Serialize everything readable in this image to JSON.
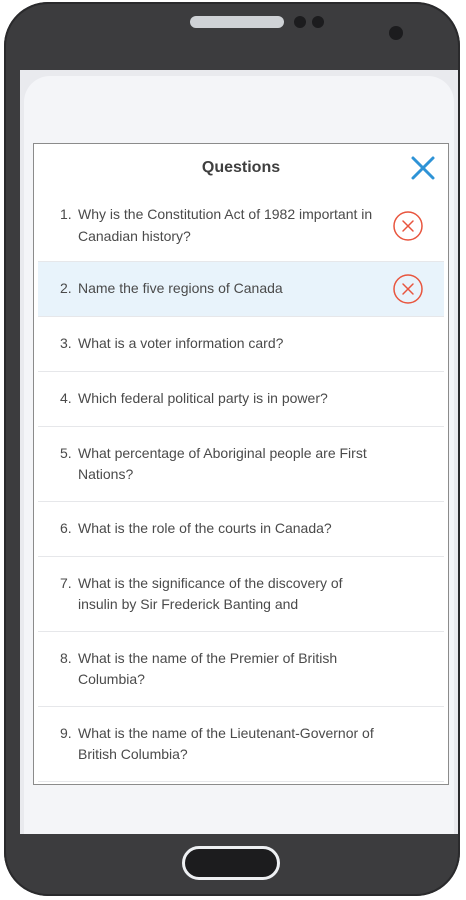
{
  "colors": {
    "accent": "#2e93d6",
    "remove": "#e8553e",
    "selected_row": "#e8f3fb",
    "phone_body": "#3c3c3e"
  },
  "modal": {
    "title": "Questions",
    "close_icon": "close-icon",
    "remove_icon": "remove-circle-x-icon"
  },
  "questions": [
    {
      "num": "1.",
      "text": "Why is the Constitution Act of 1982 important in Canadian history?",
      "removable": true,
      "selected": false
    },
    {
      "num": "2.",
      "text": "Name the five regions of Canada",
      "removable": true,
      "selected": true
    },
    {
      "num": "3.",
      "text": "What is a voter information card?",
      "removable": false,
      "selected": false
    },
    {
      "num": "4.",
      "text": "Which federal political party is in power?",
      "removable": false,
      "selected": false
    },
    {
      "num": "5.",
      "text": "What percentage of Aboriginal people are First Nations?",
      "removable": false,
      "selected": false
    },
    {
      "num": "6.",
      "text": "What is the role of the courts in Canada?",
      "removable": false,
      "selected": false
    },
    {
      "num": "7.",
      "text": "What is the significance of the discovery of insulin by Sir Frederick Banting and",
      "removable": false,
      "selected": false
    },
    {
      "num": "8.",
      "text": "What is the name of the Premier of British Columbia?",
      "removable": false,
      "selected": false
    },
    {
      "num": "9.",
      "text": "What is the name of the Lieutenant-Governor of British Columbia?",
      "removable": false,
      "selected": false
    }
  ]
}
